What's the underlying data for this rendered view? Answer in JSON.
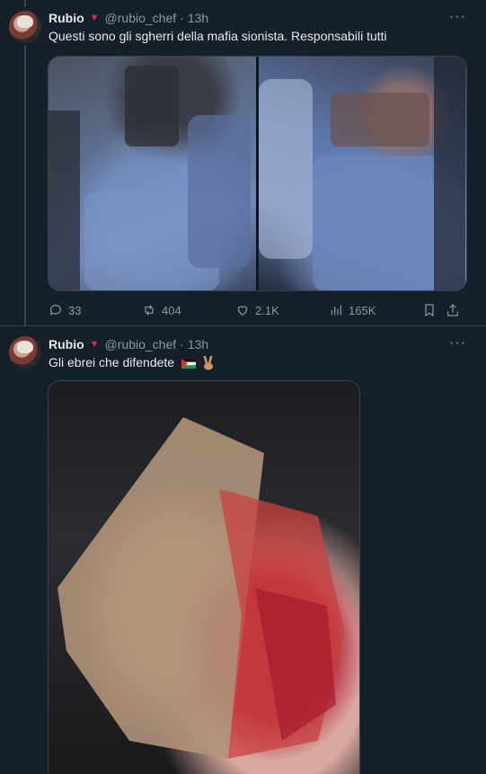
{
  "tweets": [
    {
      "name": "Rubio",
      "badge": "▼",
      "handle": "@rubio_chef",
      "sep": "·",
      "time": "13h",
      "more": "···",
      "text": "Questi sono gli sgherri della mafia sionista. Responsabili tutti",
      "media_count": 2,
      "stats": {
        "replies": "33",
        "reposts": "404",
        "likes": "2.1K",
        "views": "165K"
      }
    },
    {
      "name": "Rubio",
      "badge": "▼",
      "handle": "@rubio_chef",
      "sep": "·",
      "time": "13h",
      "more": "···",
      "text": "Gli ebrei che difendete",
      "emojis": [
        "palestine-flag",
        "victory-hand"
      ],
      "media_count": 1
    }
  ],
  "colors": {
    "background": "#15202b",
    "text": "#e7e9ea",
    "muted": "#8b98a5",
    "border": "#38444d",
    "badge": "#e0245e"
  }
}
